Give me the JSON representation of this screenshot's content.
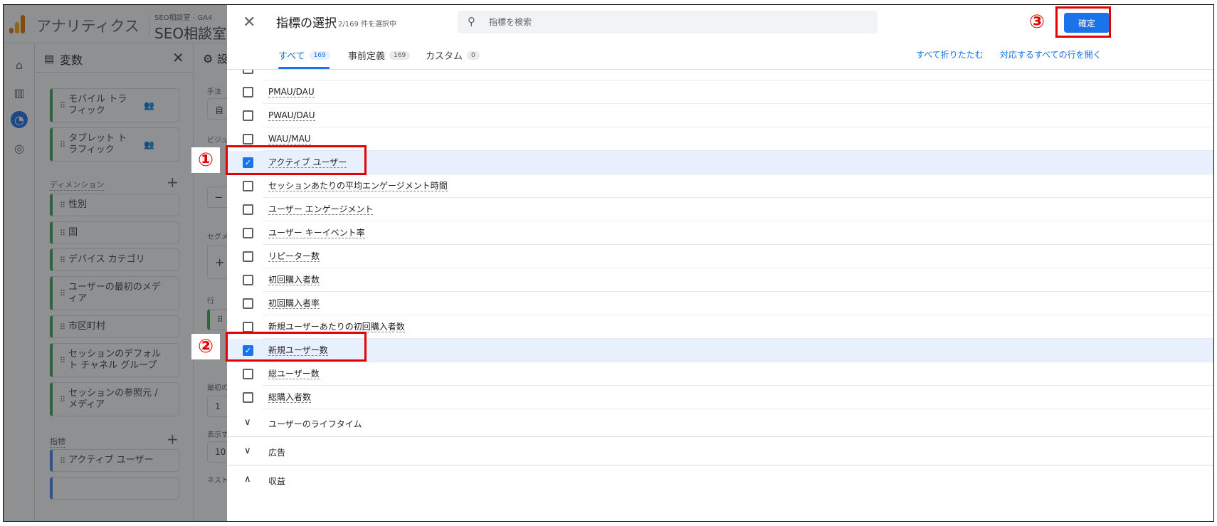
{
  "app": {
    "title": "アナリティクス",
    "property_small": "SEO相談室 - GA4",
    "property_name": "SEO相談室 - G"
  },
  "colors": {
    "accent": "#1a73e8",
    "annotation": "#e30000",
    "dimension_chip": "#34a853",
    "metric_chip": "#4285f4"
  },
  "rail": {
    "icons": [
      "home-icon",
      "reports-icon",
      "explore-icon",
      "advertising-icon"
    ]
  },
  "variables_panel": {
    "title": "変数",
    "chips_top": [
      {
        "label": "モバイル トラフィック"
      },
      {
        "label": "タブレット トラフィック"
      }
    ],
    "dimensions_label": "ディメンション",
    "dimensions": [
      {
        "label": "性別"
      },
      {
        "label": "国"
      },
      {
        "label": "デバイス カテゴリ"
      },
      {
        "label": "ユーザーの最初のメディア"
      },
      {
        "label": "市区町村"
      },
      {
        "label": "セッションのデフォルト チャネル グループ"
      },
      {
        "label": "セッションの参照元 / メディア"
      }
    ],
    "metrics_label": "指標",
    "metrics": [
      {
        "label": "アクティブ ユーザー"
      }
    ]
  },
  "settings_panel": {
    "head_clip": "設",
    "labels": [
      "手法",
      "ビジュ",
      "セグメ",
      "行",
      "最初の",
      "表示す",
      "ネスト"
    ],
    "values": [
      "自",
      "1",
      "10"
    ],
    "plus": "+"
  },
  "dialog": {
    "title": "指標の選択",
    "selected_count": "2/169 件を選択中",
    "search_placeholder": "指標を検索",
    "confirm_label": "確定",
    "tabs": [
      {
        "label": "すべて",
        "count": "169"
      },
      {
        "label": "事前定義",
        "count": "169"
      },
      {
        "label": "カスタム",
        "count": "0"
      }
    ],
    "collapse_all": "すべて折りたたむ",
    "expand_all": "対応するすべての行を開く",
    "items": [
      {
        "label": "PMAU/DAU",
        "checked": false
      },
      {
        "label": "PWAU/DAU",
        "checked": false
      },
      {
        "label": "WAU/MAU",
        "checked": false
      },
      {
        "label": "アクティブ ユーザー",
        "checked": true
      },
      {
        "label": "セッションあたりの平均エンゲージメント時間",
        "checked": false
      },
      {
        "label": "ユーザー エンゲージメント",
        "checked": false
      },
      {
        "label": "ユーザー キーイベント率",
        "checked": false
      },
      {
        "label": "リピーター数",
        "checked": false
      },
      {
        "label": "初回購入者数",
        "checked": false
      },
      {
        "label": "初回購入者率",
        "checked": false
      },
      {
        "label": "新規ユーザーあたりの初回購入者数",
        "checked": false
      },
      {
        "label": "新規ユーザー数",
        "checked": true
      },
      {
        "label": "総ユーザー数",
        "checked": false
      },
      {
        "label": "総購入者数",
        "checked": false
      }
    ],
    "groups": [
      {
        "label": "ユーザーのライフタイム",
        "expanded": false
      },
      {
        "label": "広告",
        "expanded": false
      },
      {
        "label": "収益",
        "expanded": true
      }
    ]
  },
  "annotations": [
    "①",
    "②",
    "③"
  ]
}
